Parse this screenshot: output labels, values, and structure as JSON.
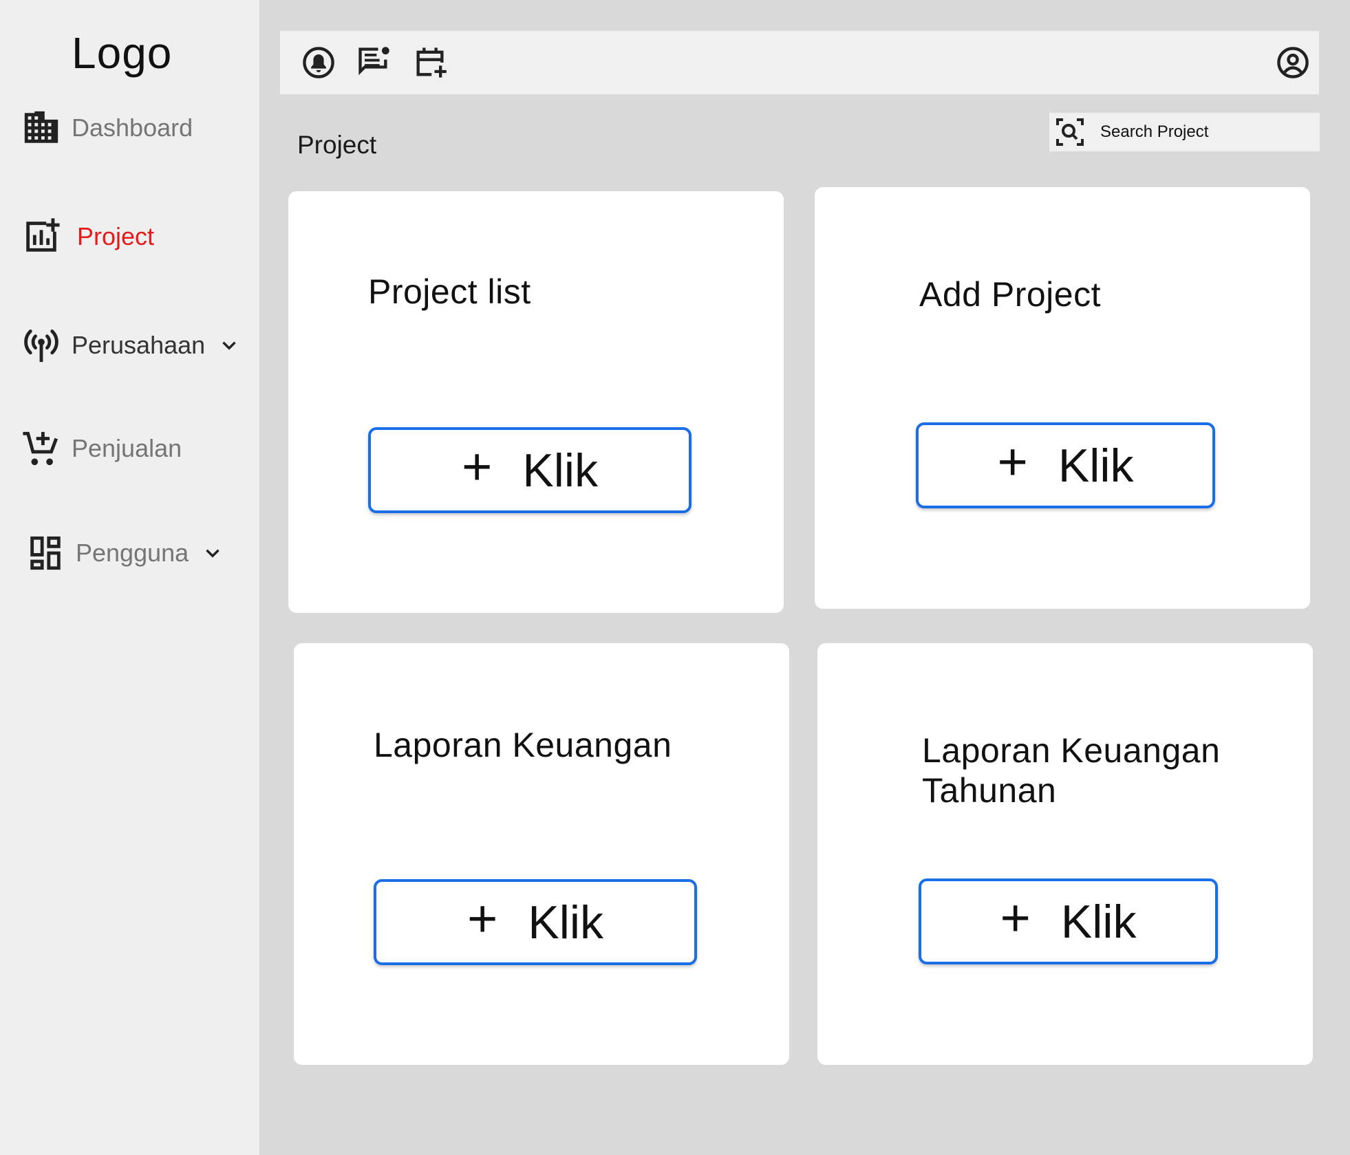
{
  "sidebar": {
    "logo": "Logo",
    "items": [
      {
        "label": "Dashboard",
        "icon": "building-icon"
      },
      {
        "label": "Project",
        "icon": "chart-add-icon",
        "active": true
      },
      {
        "label": "Perusahaan",
        "icon": "antenna-icon",
        "expandable": true
      },
      {
        "label": "Penjualan",
        "icon": "cart-add-icon"
      },
      {
        "label": "Pengguna",
        "icon": "dashboard-grid-icon",
        "expandable": true
      }
    ]
  },
  "topbar": {
    "icons": [
      "alarm-icon",
      "chat-icon",
      "calendar-add-icon",
      "account-icon"
    ]
  },
  "page": {
    "title": "Project",
    "search_placeholder": "Search Project"
  },
  "cards": [
    {
      "title": "Project list",
      "button_label": "Klik",
      "button_icon": "plus-icon"
    },
    {
      "title": "Add Project",
      "button_label": "Klik",
      "button_icon": "plus-icon"
    },
    {
      "title": "Laporan Keuangan",
      "button_label": "Klik",
      "button_icon": "plus-icon"
    },
    {
      "title": "Laporan Keuangan Tahunan",
      "button_label": "Klik",
      "button_icon": "plus-icon"
    }
  ],
  "colors": {
    "active_nav": "#e31b1b",
    "button_border": "#1a6fe8",
    "sidebar_bg": "#efefef",
    "content_bg": "#d9d9d9"
  }
}
